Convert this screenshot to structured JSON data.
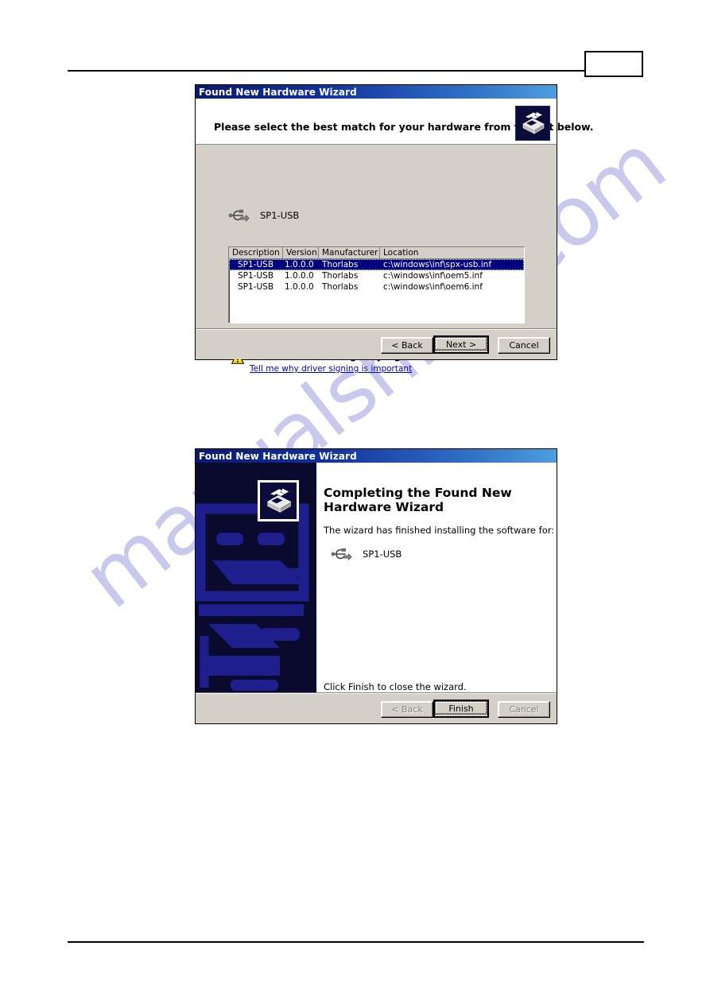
{
  "page": {
    "page_number_box": ""
  },
  "watermark": {
    "text": "manualshive.com",
    "color": "#c9c9ee"
  },
  "dialog_one": {
    "title": "Found New Hardware Wizard",
    "heading": "Please select the best match for your hardware from the list below.",
    "device_name": "SP1-USB",
    "device_icon": "usb-icon",
    "header_icon": "hardware-wizard-icon",
    "list": {
      "columns": [
        "Description",
        "Version",
        "Manufacturer",
        "Location"
      ],
      "rows": [
        {
          "description": "SP1-USB",
          "version": "1.0.0.0",
          "manufacturer": "Thorlabs",
          "location": "c:\\windows\\inf\\spx-usb.inf",
          "selected": true
        },
        {
          "description": "SP1-USB",
          "version": "1.0.0.0",
          "manufacturer": "Thorlabs",
          "location": "c:\\windows\\inf\\oem5.inf",
          "selected": false
        },
        {
          "description": "SP1-USB",
          "version": "1.0.0.0",
          "manufacturer": "Thorlabs",
          "location": "c:\\windows\\inf\\oem6.inf",
          "selected": false
        }
      ]
    },
    "warning": {
      "icon": "warning-triangle-icon",
      "text": "This driver is not digitally signed!",
      "link": "Tell me why driver signing is important"
    },
    "buttons": {
      "back": "< Back",
      "next": "Next >",
      "cancel": "Cancel",
      "default": "next"
    }
  },
  "dialog_two": {
    "title": "Found New Hardware Wizard",
    "banner_icon": "hardware-wizard-icon",
    "heading_line1": "Completing the Found New",
    "heading_line2": "Hardware Wizard",
    "subtitle": "The wizard has finished installing the software for:",
    "device_name": "SP1-USB",
    "device_icon": "usb-icon",
    "footer_text": "Click Finish to close the wizard.",
    "buttons": {
      "back": "< Back",
      "finish": "Finish",
      "cancel": "Cancel",
      "default": "finish",
      "back_disabled": true,
      "cancel_disabled": true
    }
  }
}
